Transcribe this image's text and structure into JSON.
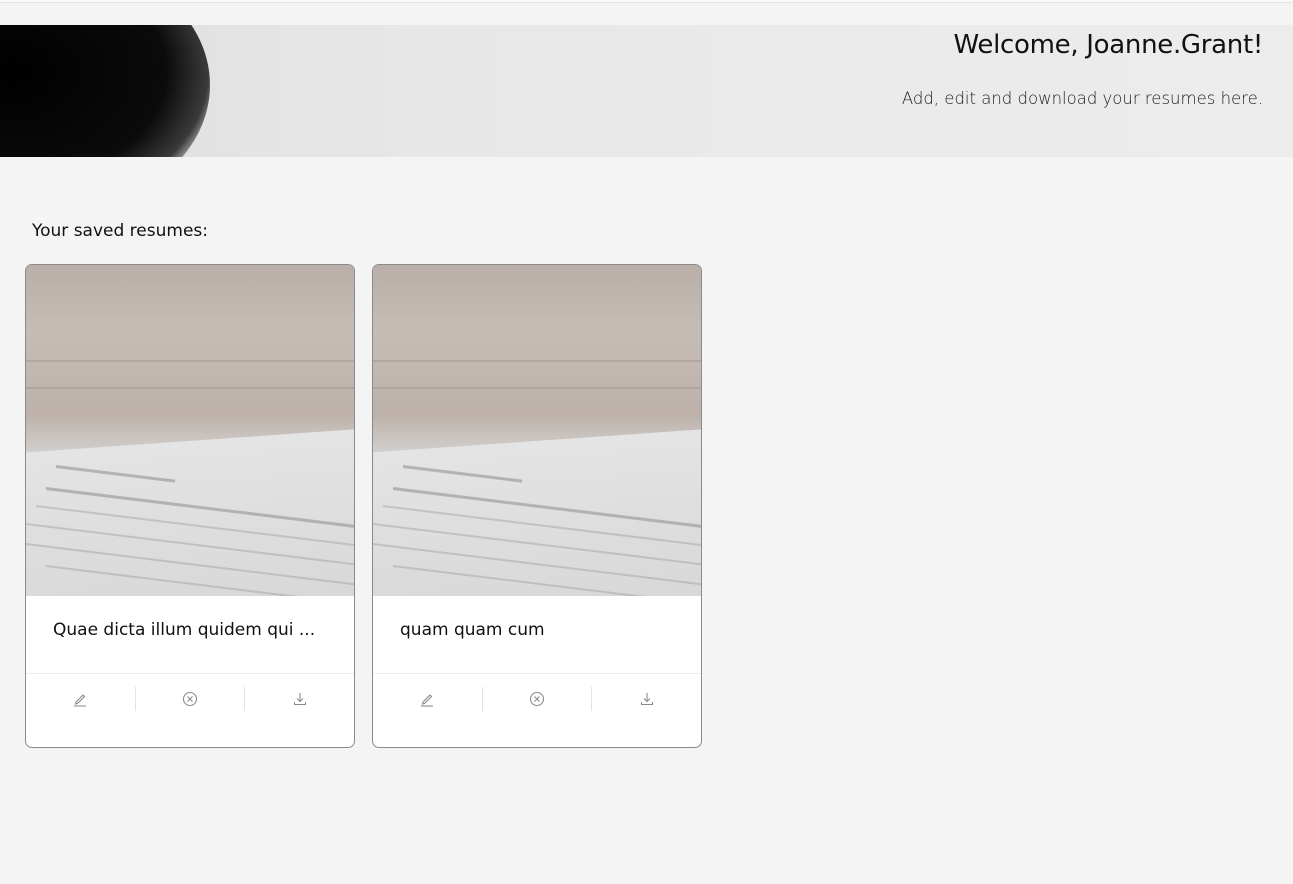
{
  "header": {
    "title": "Welcome, Joanne.Grant!",
    "subtitle": "Add, edit and download your resumes here."
  },
  "main": {
    "section_label": "Your saved resumes:",
    "resumes": [
      {
        "title": "Quae dicta illum quidem qui ...",
        "actions": [
          "edit-icon",
          "delete-icon",
          "download-icon"
        ]
      },
      {
        "title": "quam quam cum",
        "actions": [
          "edit-icon",
          "delete-icon",
          "download-icon"
        ]
      }
    ]
  },
  "colors": {
    "background": "#f4f4f4",
    "card": "#ffffff",
    "card_border": "#8a8a8a",
    "icon": "#8a8a8a"
  }
}
